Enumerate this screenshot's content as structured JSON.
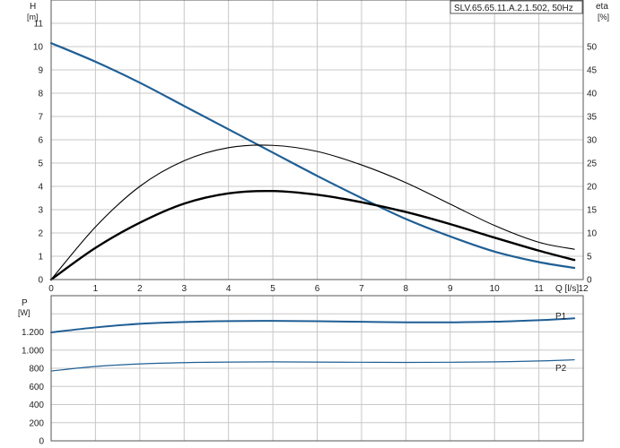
{
  "chart_data": [
    {
      "type": "line",
      "title": "SLV.65.65.11.A.2.1.502, 50Hz",
      "xlabel": "Q [l/s]",
      "ylabel": "H",
      "ylabel_unit": "[m]",
      "y2label": "eta",
      "y2label_unit": "[%]",
      "xlim": [
        0,
        12
      ],
      "ylim": [
        0,
        12
      ],
      "y2lim": [
        0,
        60
      ],
      "grid": true,
      "x_ticks": [
        "0",
        "1",
        "2",
        "3",
        "4",
        "5",
        "6",
        "7",
        "8",
        "9",
        "10",
        "11",
        "12"
      ],
      "y_ticks": [
        "0",
        "1",
        "2",
        "3",
        "4",
        "5",
        "6",
        "7",
        "8",
        "9",
        "10",
        "11"
      ],
      "y2_ticks": [
        "0",
        "5",
        "10",
        "15",
        "20",
        "25",
        "30",
        "35",
        "40",
        "45",
        "50"
      ],
      "series": [
        {
          "axis": "left",
          "color": "#1f5f95",
          "x": [
            0,
            1,
            2,
            3,
            4,
            5,
            6,
            7,
            8,
            9,
            10,
            11,
            11.8
          ],
          "values": [
            10.15,
            9.35,
            8.45,
            7.45,
            6.45,
            5.45,
            4.45,
            3.5,
            2.6,
            1.85,
            1.2,
            0.75,
            0.5
          ]
        },
        {
          "axis": "right",
          "color": "#000000",
          "x": [
            0,
            1,
            2,
            3,
            4,
            5,
            6,
            7,
            8,
            9,
            10,
            11,
            11.8
          ],
          "values": [
            0,
            11.3,
            20.0,
            25.5,
            28.3,
            28.8,
            27.5,
            24.6,
            20.8,
            16.2,
            11.6,
            8.0,
            6.5
          ]
        },
        {
          "axis": "right",
          "color": "#000000",
          "bold": true,
          "x": [
            0,
            1,
            2,
            3,
            4,
            5,
            6,
            7,
            8,
            9,
            10,
            11,
            11.8
          ],
          "values": [
            0,
            6.8,
            12.2,
            16.3,
            18.5,
            19.0,
            18.2,
            16.6,
            14.5,
            11.9,
            9.0,
            6.2,
            4.2
          ]
        }
      ]
    },
    {
      "type": "line",
      "ylabel": "P",
      "ylabel_unit": "[W]",
      "xlim": [
        0,
        12
      ],
      "ylim": [
        0,
        1600
      ],
      "grid": true,
      "y_ticks": [
        "0",
        "200",
        "400",
        "600",
        "800",
        "1.000",
        "1.200"
      ],
      "series": [
        {
          "name": "P1",
          "color": "#1f5f95",
          "bold": true,
          "x": [
            0,
            1,
            2,
            3,
            4,
            5,
            6,
            7,
            8,
            9,
            10,
            11,
            11.8
          ],
          "values": [
            1195,
            1250,
            1290,
            1310,
            1320,
            1322,
            1318,
            1312,
            1306,
            1306,
            1313,
            1330,
            1350
          ]
        },
        {
          "name": "P2",
          "color": "#1f5f95",
          "x": [
            0,
            1,
            2,
            3,
            4,
            5,
            6,
            7,
            8,
            9,
            10,
            11,
            11.8
          ],
          "values": [
            770,
            820,
            848,
            862,
            868,
            870,
            868,
            866,
            864,
            866,
            870,
            880,
            893
          ]
        }
      ]
    }
  ]
}
